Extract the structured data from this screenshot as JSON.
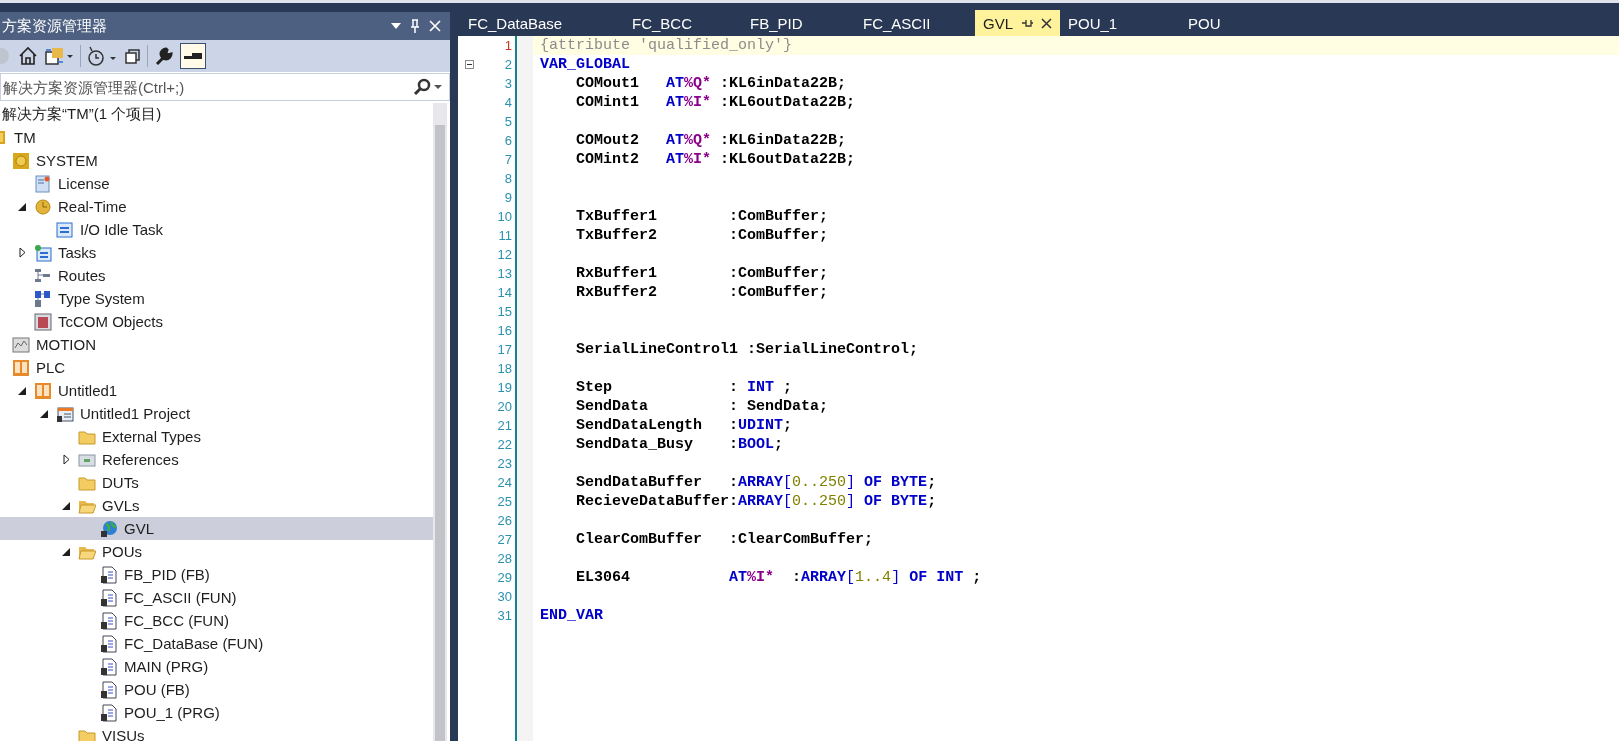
{
  "explorer": {
    "title": "方案资源管理器",
    "search": {
      "placeholder": "解决方案资源管理器(Ctrl+;)"
    },
    "tree": {
      "root_label": "解决方案“TM”(1 个项目)",
      "items": [
        {
          "label": "TM",
          "kind": "project",
          "selected": false,
          "children": [
            {
              "label": "SYSTEM",
              "kind": "system",
              "selected": false,
              "children": [
                {
                  "label": "License",
                  "kind": "license",
                  "selected": false
                },
                {
                  "label": "Real-Time",
                  "kind": "realtime",
                  "selected": false,
                  "expanded": true,
                  "children": [
                    {
                      "label": "I/O Idle Task",
                      "kind": "task",
                      "selected": false
                    }
                  ]
                },
                {
                  "label": "Tasks",
                  "kind": "tasks",
                  "selected": false,
                  "expanded": false
                },
                {
                  "label": "Routes",
                  "kind": "routes",
                  "selected": false
                },
                {
                  "label": "Type System",
                  "kind": "typesystem",
                  "selected": false
                },
                {
                  "label": "TcCOM Objects",
                  "kind": "tccom",
                  "selected": false
                }
              ]
            },
            {
              "label": "MOTION",
              "kind": "motion",
              "selected": false
            },
            {
              "label": "PLC",
              "kind": "plc",
              "selected": false,
              "children": [
                {
                  "label": "Untitled1",
                  "kind": "plc",
                  "selected": false,
                  "expanded": true,
                  "children": [
                    {
                      "label": "Untitled1 Project",
                      "kind": "plcproject",
                      "selected": false,
                      "expanded": true,
                      "children": [
                        {
                          "label": "External Types",
                          "kind": "folder",
                          "selected": false
                        },
                        {
                          "label": "References",
                          "kind": "references",
                          "selected": false,
                          "expanded": false
                        },
                        {
                          "label": "DUTs",
                          "kind": "folder",
                          "selected": false
                        },
                        {
                          "label": "GVLs",
                          "kind": "folder",
                          "selected": false,
                          "expanded": true,
                          "children": [
                            {
                              "label": "GVL",
                              "kind": "gvl",
                              "selected": true
                            }
                          ]
                        },
                        {
                          "label": "POUs",
                          "kind": "folder",
                          "selected": false,
                          "expanded": true,
                          "children": [
                            {
                              "label": "FB_PID (FB)",
                              "kind": "pou",
                              "selected": false
                            },
                            {
                              "label": "FC_ASCII (FUN)",
                              "kind": "pou",
                              "selected": false
                            },
                            {
                              "label": "FC_BCC (FUN)",
                              "kind": "pou",
                              "selected": false
                            },
                            {
                              "label": "FC_DataBase (FUN)",
                              "kind": "pou",
                              "selected": false
                            },
                            {
                              "label": "MAIN (PRG)",
                              "kind": "pou",
                              "selected": false
                            },
                            {
                              "label": "POU (FB)",
                              "kind": "pou",
                              "selected": false
                            },
                            {
                              "label": "POU_1 (PRG)",
                              "kind": "pou",
                              "selected": false
                            }
                          ]
                        },
                        {
                          "label": "VISUs",
                          "kind": "folder",
                          "selected": false
                        }
                      ]
                    }
                  ]
                }
              ]
            }
          ]
        }
      ]
    }
  },
  "tabs": [
    {
      "label": "FC_DataBase",
      "selected": false
    },
    {
      "label": "FC_BCC",
      "selected": false
    },
    {
      "label": "FB_PID",
      "selected": false
    },
    {
      "label": "FC_ASCII",
      "selected": false
    },
    {
      "label": "GVL",
      "selected": true
    },
    {
      "label": "POU_1",
      "selected": false
    },
    {
      "label": "POU",
      "selected": false
    }
  ],
  "code": {
    "lines": [
      {
        "number": "1",
        "highlighted": true,
        "tokens": [
          {
            "kind": "pragma",
            "text": "{attribute 'qualified_only'}"
          }
        ]
      },
      {
        "number": "2",
        "highlighted": false,
        "foldable": true,
        "tokens": [
          {
            "kind": "keyword",
            "text": "VAR_GLOBAL"
          }
        ]
      },
      {
        "number": "3",
        "highlighted": false,
        "tokens": [
          {
            "kind": "plain",
            "text": "    COMout1   "
          },
          {
            "kind": "keyword",
            "text": "AT"
          },
          {
            "kind": "address",
            "text": "%Q*"
          },
          {
            "kind": "plain",
            "text": " :KL6inData22B;"
          }
        ]
      },
      {
        "number": "4",
        "highlighted": false,
        "tokens": [
          {
            "kind": "plain",
            "text": "    COMint1   "
          },
          {
            "kind": "keyword",
            "text": "AT"
          },
          {
            "kind": "address",
            "text": "%I*"
          },
          {
            "kind": "plain",
            "text": " :KL6outData22B;"
          }
        ]
      },
      {
        "number": "5",
        "highlighted": false
      },
      {
        "number": "6",
        "highlighted": false,
        "tokens": [
          {
            "kind": "plain",
            "text": "    COMout2   "
          },
          {
            "kind": "keyword",
            "text": "AT"
          },
          {
            "kind": "address",
            "text": "%Q*"
          },
          {
            "kind": "plain",
            "text": " :KL6inData22B;"
          }
        ]
      },
      {
        "number": "7",
        "highlighted": false,
        "tokens": [
          {
            "kind": "plain",
            "text": "    COMint2   "
          },
          {
            "kind": "keyword",
            "text": "AT"
          },
          {
            "kind": "address",
            "text": "%I*"
          },
          {
            "kind": "plain",
            "text": " :KL6outData22B;"
          }
        ]
      },
      {
        "number": "8",
        "highlighted": false
      },
      {
        "number": "9",
        "highlighted": false
      },
      {
        "number": "10",
        "highlighted": false,
        "tokens": [
          {
            "kind": "plain",
            "text": "    TxBuffer1        :ComBuffer;"
          }
        ]
      },
      {
        "number": "11",
        "highlighted": false,
        "tokens": [
          {
            "kind": "plain",
            "text": "    TxBuffer2        :ComBuffer;"
          }
        ]
      },
      {
        "number": "12",
        "highlighted": false
      },
      {
        "number": "13",
        "highlighted": false,
        "tokens": [
          {
            "kind": "plain",
            "text": "    RxBuffer1        :ComBuffer;"
          }
        ]
      },
      {
        "number": "14",
        "highlighted": false,
        "tokens": [
          {
            "kind": "plain",
            "text": "    RxBuffer2        :ComBuffer;"
          }
        ]
      },
      {
        "number": "15",
        "highlighted": false
      },
      {
        "number": "16",
        "highlighted": false
      },
      {
        "number": "17",
        "highlighted": false,
        "tokens": [
          {
            "kind": "plain",
            "text": "    SerialLineControl1 :SerialLineControl;"
          }
        ]
      },
      {
        "number": "18",
        "highlighted": false
      },
      {
        "number": "19",
        "highlighted": false,
        "tokens": [
          {
            "kind": "plain",
            "text": "    Step             : "
          },
          {
            "kind": "keyword",
            "text": "INT"
          },
          {
            "kind": "plain",
            "text": " ;"
          }
        ]
      },
      {
        "number": "20",
        "highlighted": false,
        "tokens": [
          {
            "kind": "plain",
            "text": "    SendData         : SendData;"
          }
        ]
      },
      {
        "number": "21",
        "highlighted": false,
        "tokens": [
          {
            "kind": "plain",
            "text": "    SendDataLength   :"
          },
          {
            "kind": "keyword",
            "text": "UDINT"
          },
          {
            "kind": "plain",
            "text": ";"
          }
        ]
      },
      {
        "number": "22",
        "highlighted": false,
        "tokens": [
          {
            "kind": "plain",
            "text": "    SendData_Busy    :"
          },
          {
            "kind": "keyword",
            "text": "BOOL"
          },
          {
            "kind": "plain",
            "text": ";"
          }
        ]
      },
      {
        "number": "23",
        "highlighted": false
      },
      {
        "number": "24",
        "highlighted": false,
        "tokens": [
          {
            "kind": "plain",
            "text": "    SendDataBuffer   :"
          },
          {
            "kind": "keyword",
            "text": "ARRAY"
          },
          {
            "kind": "bracket",
            "text": "["
          },
          {
            "kind": "number",
            "text": "0..250"
          },
          {
            "kind": "bracket",
            "text": "]"
          },
          {
            "kind": "keyword",
            "text": " OF BYTE"
          },
          {
            "kind": "plain",
            "text": ";"
          }
        ]
      },
      {
        "number": "25",
        "highlighted": false,
        "tokens": [
          {
            "kind": "plain",
            "text": "    RecieveDataBuffer:"
          },
          {
            "kind": "keyword",
            "text": "ARRAY"
          },
          {
            "kind": "bracket",
            "text": "["
          },
          {
            "kind": "number",
            "text": "0..250"
          },
          {
            "kind": "bracket",
            "text": "]"
          },
          {
            "kind": "keyword",
            "text": " OF BYTE"
          },
          {
            "kind": "plain",
            "text": ";"
          }
        ]
      },
      {
        "number": "26",
        "highlighted": false
      },
      {
        "number": "27",
        "highlighted": false,
        "tokens": [
          {
            "kind": "plain",
            "text": "    ClearComBuffer   :ClearComBuffer;"
          }
        ]
      },
      {
        "number": "28",
        "highlighted": false
      },
      {
        "number": "29",
        "highlighted": false,
        "tokens": [
          {
            "kind": "plain",
            "text": "    EL3064           "
          },
          {
            "kind": "keyword",
            "text": "AT"
          },
          {
            "kind": "address",
            "text": "%I*"
          },
          {
            "kind": "plain",
            "text": "  :"
          },
          {
            "kind": "keyword",
            "text": "ARRAY"
          },
          {
            "kind": "bracket",
            "text": "["
          },
          {
            "kind": "number",
            "text": "1..4"
          },
          {
            "kind": "bracket",
            "text": "]"
          },
          {
            "kind": "keyword",
            "text": " OF INT"
          },
          {
            "kind": "plain",
            "text": " ;"
          }
        ]
      },
      {
        "number": "30",
        "highlighted": false
      },
      {
        "number": "31",
        "highlighted": false,
        "tokens": [
          {
            "kind": "keyword",
            "text": "END_VAR"
          }
        ]
      }
    ]
  }
}
